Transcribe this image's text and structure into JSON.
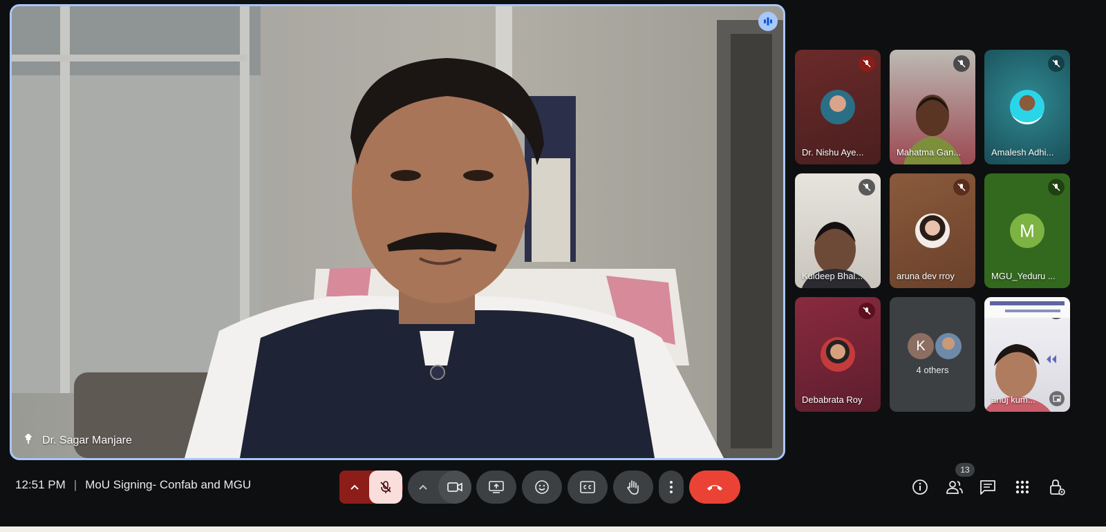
{
  "main_speaker": {
    "name": "Dr. Sagar Manjare"
  },
  "participants": [
    {
      "name": "Dr. Nishu Aye...",
      "muted": true
    },
    {
      "name": "Mahatma Gan...",
      "muted": true
    },
    {
      "name": "Amalesh Adhi...",
      "muted": true
    },
    {
      "name": "Kuldeep Bhal...",
      "muted": true
    },
    {
      "name": "aruna dev rroy",
      "muted": true
    },
    {
      "name": "MGU_Yeduru ...",
      "muted": true,
      "initial": "M"
    },
    {
      "name": "Debabrata Roy",
      "muted": true
    },
    {
      "name": "4 others",
      "initial": "K"
    },
    {
      "name": "anuj kum...",
      "muted": true
    }
  ],
  "meeting": {
    "time": "12:51 PM",
    "separator": "|",
    "title": "MoU Signing- Confab and MGU"
  },
  "people_count": "13",
  "colors": {
    "accent": "#a8c7fa",
    "end_call": "#ea4335",
    "mic_off_bg": "#f9dedc",
    "mic_off_dark": "#8c1d18",
    "control_bg": "#3c4043"
  },
  "icons": {
    "speaking": "audio-wave-icon",
    "pin": "pin-icon",
    "mic_off": "mic-off-icon",
    "camera": "camera-icon",
    "present": "present-screen-icon",
    "emoji": "emoji-icon",
    "captions": "captions-icon",
    "raise_hand": "raise-hand-icon",
    "more": "more-options-icon",
    "end_call": "end-call-icon",
    "info": "info-icon",
    "people": "people-icon",
    "chat": "chat-icon",
    "activities": "activities-icon",
    "host_controls": "host-controls-icon"
  }
}
